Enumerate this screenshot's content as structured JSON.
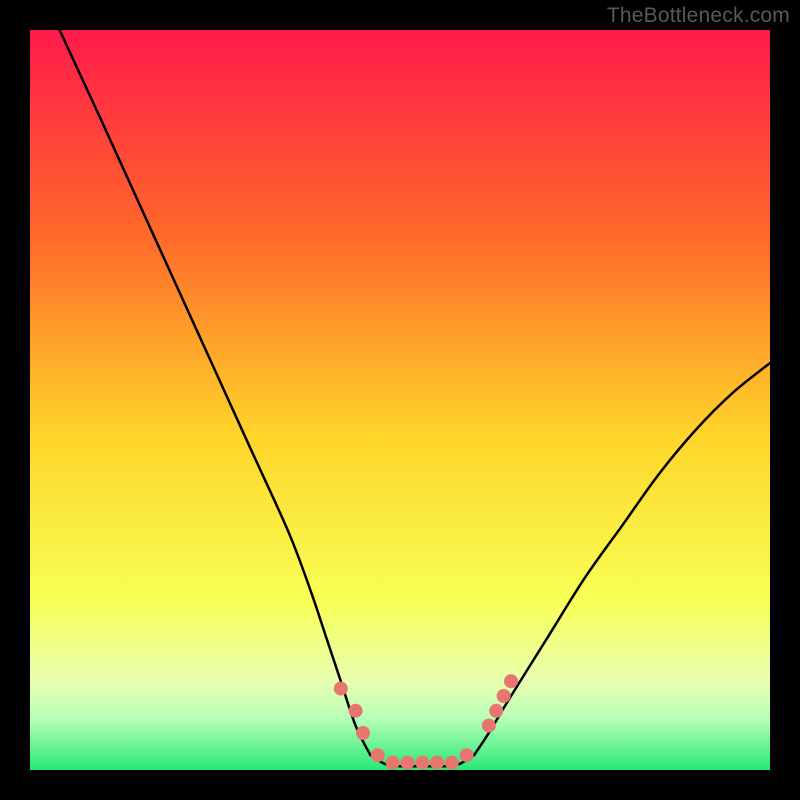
{
  "attribution": "TheBottleneck.com",
  "colors": {
    "bg": "#000000",
    "text": "#595959",
    "gradient_top": "#ff1a4b",
    "gradient_mid1": "#ff8a2a",
    "gradient_mid2": "#ffe02a",
    "gradient_mid3": "#f4ff6a",
    "gradient_bottom": "#2fe87a",
    "curve": "#000000",
    "dots": "#e8766e"
  },
  "chart_data": {
    "type": "line",
    "title": "",
    "xlabel": "",
    "ylabel": "",
    "xlim": [
      0,
      100
    ],
    "ylim": [
      0,
      100
    ],
    "series": [
      {
        "name": "left-branch",
        "x": [
          4,
          10,
          15,
          20,
          25,
          30,
          35,
          38,
          40,
          42,
          44,
          46
        ],
        "values": [
          100,
          87,
          76,
          65,
          54,
          43,
          32,
          24,
          18,
          12,
          6,
          2
        ]
      },
      {
        "name": "valley-floor",
        "x": [
          46,
          48,
          50,
          52,
          54,
          56,
          58,
          60
        ],
        "values": [
          2,
          0.8,
          0.5,
          0.5,
          0.5,
          0.5,
          0.8,
          2
        ]
      },
      {
        "name": "right-branch",
        "x": [
          60,
          62,
          65,
          70,
          75,
          80,
          85,
          90,
          95,
          100
        ],
        "values": [
          2,
          5,
          10,
          18,
          26,
          33,
          40,
          46,
          51,
          55
        ]
      }
    ],
    "points": [
      {
        "x": 42,
        "y": 11
      },
      {
        "x": 44,
        "y": 8
      },
      {
        "x": 45,
        "y": 5
      },
      {
        "x": 47,
        "y": 2
      },
      {
        "x": 49,
        "y": 1
      },
      {
        "x": 51,
        "y": 1
      },
      {
        "x": 53,
        "y": 1
      },
      {
        "x": 55,
        "y": 1
      },
      {
        "x": 57,
        "y": 1
      },
      {
        "x": 59,
        "y": 2
      },
      {
        "x": 62,
        "y": 6
      },
      {
        "x": 63,
        "y": 8
      },
      {
        "x": 64,
        "y": 10
      },
      {
        "x": 65,
        "y": 12
      }
    ],
    "gradient_stops": [
      {
        "offset": 0,
        "color": "#ff1a4b"
      },
      {
        "offset": 28,
        "color": "#ff6a2a"
      },
      {
        "offset": 55,
        "color": "#ffd52a"
      },
      {
        "offset": 77,
        "color": "#f8ff55"
      },
      {
        "offset": 88,
        "color": "#e8ffb0"
      },
      {
        "offset": 93,
        "color": "#b8ffb8"
      },
      {
        "offset": 100,
        "color": "#28e878"
      }
    ]
  }
}
